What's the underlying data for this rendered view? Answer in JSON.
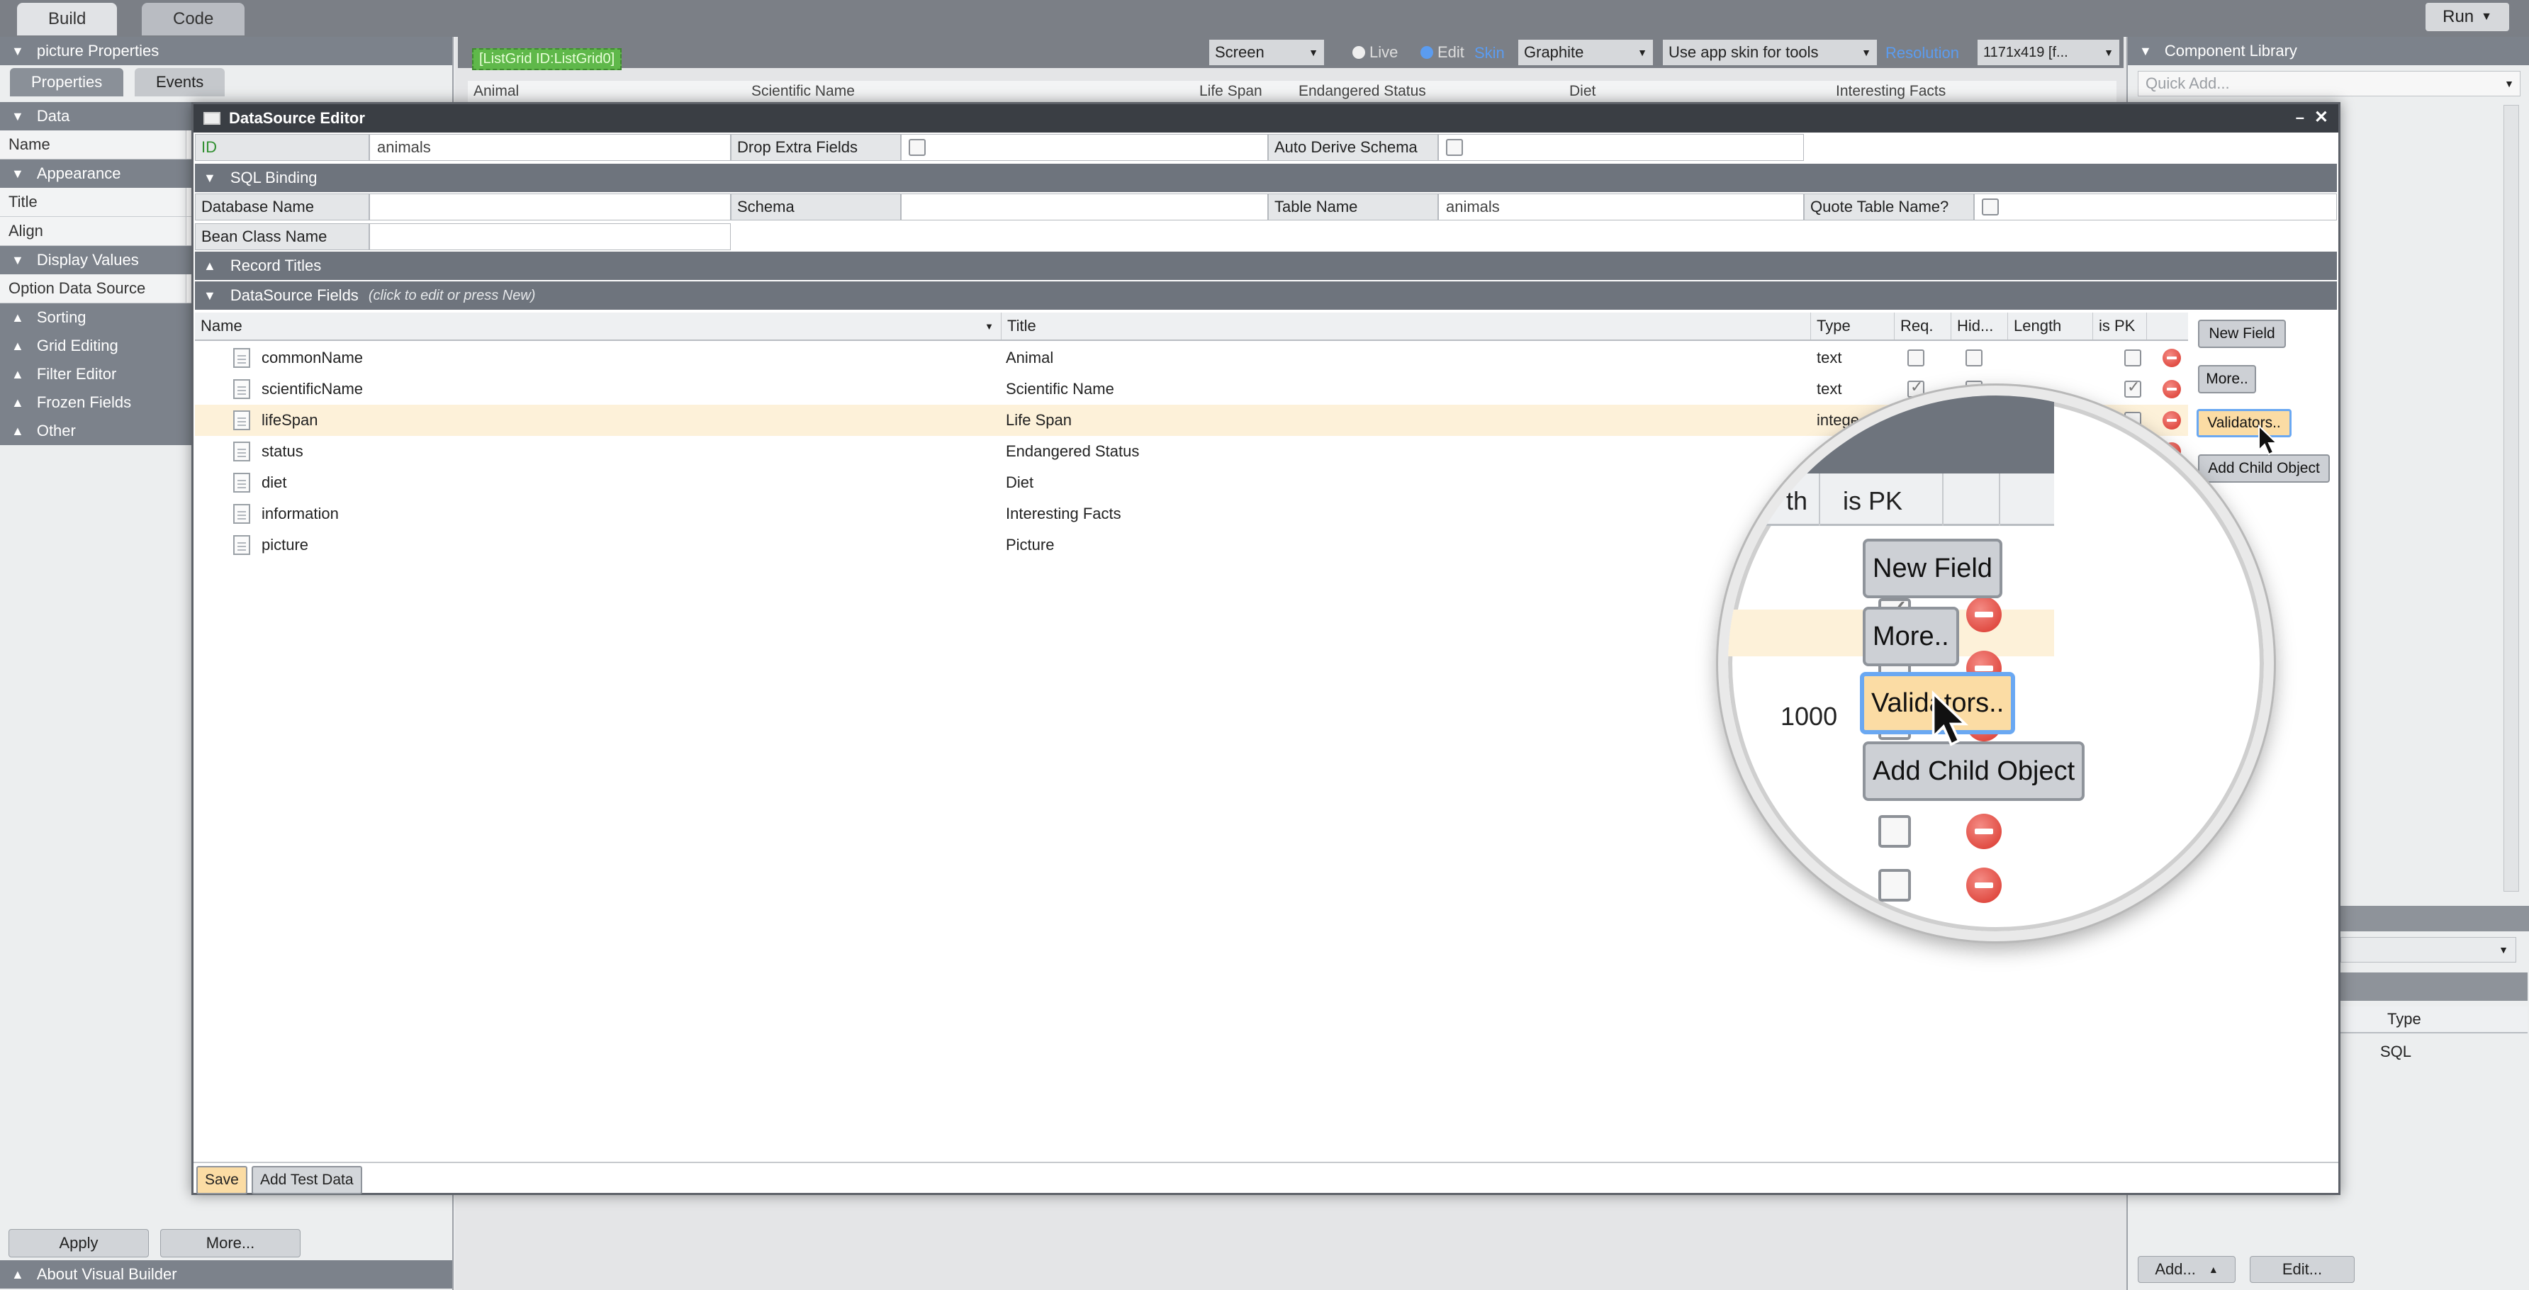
{
  "topbar": {
    "tabs": [
      "Build",
      "Code"
    ],
    "run_label": "Run"
  },
  "left_panel": {
    "title": "picture Properties",
    "tabs": [
      "Properties",
      "Events"
    ],
    "sections": {
      "data": "Data",
      "appearance": "Appearance",
      "display_values": "Display Values",
      "sorting": "Sorting",
      "grid_editing": "Grid Editing",
      "filter_editor": "Filter Editor",
      "frozen_fields": "Frozen Fields",
      "other": "Other"
    },
    "rows": {
      "name": "Name",
      "title": "Title",
      "align": "Align",
      "option_data_source": "Option Data Source"
    },
    "buttons": {
      "apply": "Apply",
      "more": "More..."
    },
    "about": "About Visual Builder"
  },
  "canvas_toolbar": {
    "component_tag": "[ListGrid ID:ListGrid0]",
    "screen_select": "Screen",
    "live_label": "Live",
    "edit_label": "Edit",
    "skin_label": "Skin",
    "skin_select": "Graphite",
    "app_skin_select": "Use app skin for tools",
    "resolution_label": "Resolution",
    "resolution_select": "1171x419 [f..."
  },
  "bg_grid_headers": [
    "Animal",
    "Scientific Name",
    "Life Span",
    "Endangered Status",
    "Diet",
    "Interesting Facts"
  ],
  "right_panel": {
    "title": "Component Library",
    "search_placeholder": "Quick Add...",
    "table_headers": [
      "Type"
    ],
    "table_value": "SQL",
    "add_button": "Add...",
    "edit_button": "Edit..."
  },
  "modal": {
    "title": "DataSource Editor",
    "form": {
      "id_label": "ID",
      "id_value": "animals",
      "drop_extra_label": "Drop Extra Fields",
      "auto_derive_label": "Auto Derive Schema"
    },
    "sql_section": "SQL Binding",
    "sql": {
      "database_name_label": "Database Name",
      "schema_label": "Schema",
      "table_name_label": "Table Name",
      "table_name_value": "animals",
      "quote_table_label": "Quote Table Name?",
      "bean_class_label": "Bean Class Name"
    },
    "record_titles_section": "Record Titles",
    "fields_section": "DataSource Fields",
    "fields_hint": "(click to edit or press New)",
    "columns": [
      "Name",
      "Title",
      "Type",
      "Req.",
      "Hid...",
      "Length",
      "is PK"
    ],
    "rows": [
      {
        "name": "commonName",
        "title": "Animal",
        "type": "text",
        "req": false,
        "pk": false
      },
      {
        "name": "scientificName",
        "title": "Scientific Name",
        "type": "text",
        "req": true,
        "pk": true
      },
      {
        "name": "lifeSpan",
        "title": "Life Span",
        "type": "intege",
        "req": false,
        "pk": false
      },
      {
        "name": "status",
        "title": "Endangered Status",
        "type": "",
        "req": false,
        "pk": false
      },
      {
        "name": "diet",
        "title": "Diet",
        "type": "",
        "req": false,
        "pk": false
      },
      {
        "name": "information",
        "title": "Interesting Facts",
        "type": "",
        "req": false,
        "pk": false
      },
      {
        "name": "picture",
        "title": "Picture",
        "type": "",
        "req": false,
        "pk": false
      }
    ],
    "side_buttons": {
      "new_field": "New Field",
      "more": "More..",
      "validators": "Validators..",
      "add_child": "Add Child Object"
    },
    "footer": {
      "save": "Save",
      "add_test_data": "Add Test Data"
    }
  },
  "magnifier": {
    "header_partial": "th",
    "header_pk": "is PK",
    "length_value": "1000"
  },
  "colors": {
    "header_gray": "#7c828b",
    "section_gray": "#6e747d",
    "selected_row": "#fdf1d9",
    "highlight_button": "#fbdca4",
    "focus_ring": "#6aa8f2",
    "remove_red": "#d9342a"
  }
}
